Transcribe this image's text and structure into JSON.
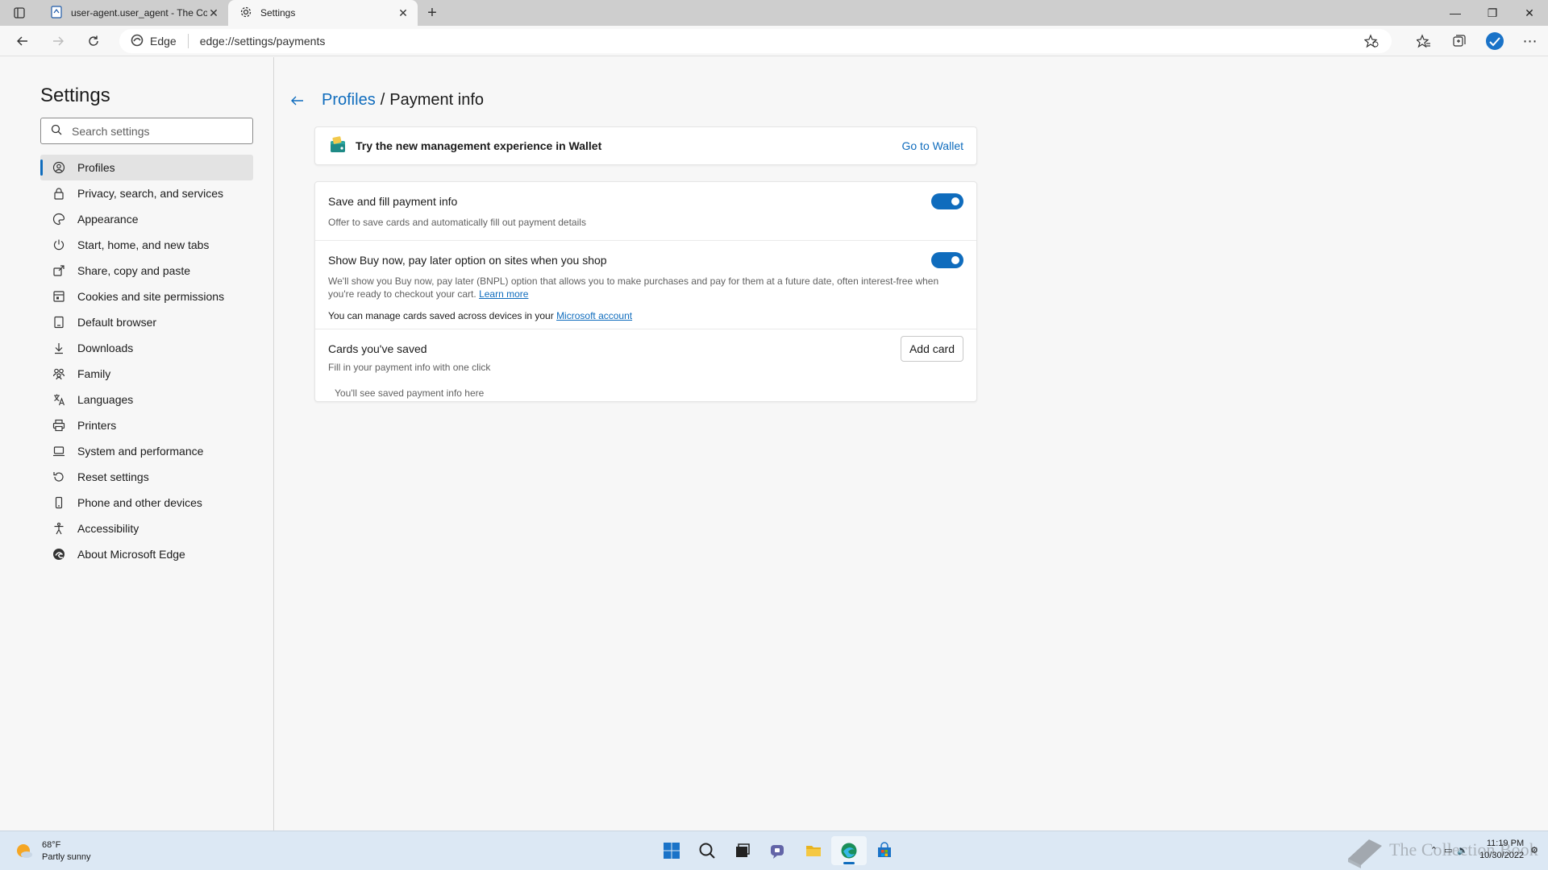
{
  "tabs": [
    {
      "title": "user-agent.user_agent - The Coll",
      "active": false
    },
    {
      "title": "Settings",
      "active": true
    }
  ],
  "address": {
    "site_label": "Edge",
    "url": "edge://settings/payments"
  },
  "sidebar": {
    "title": "Settings",
    "search_placeholder": "Search settings",
    "items": [
      {
        "label": "Profiles",
        "icon": "profile-icon"
      },
      {
        "label": "Privacy, search, and services",
        "icon": "lock-icon"
      },
      {
        "label": "Appearance",
        "icon": "palette-icon"
      },
      {
        "label": "Start, home, and new tabs",
        "icon": "power-icon"
      },
      {
        "label": "Share, copy and paste",
        "icon": "share-icon"
      },
      {
        "label": "Cookies and site permissions",
        "icon": "cookie-icon"
      },
      {
        "label": "Default browser",
        "icon": "browser-icon"
      },
      {
        "label": "Downloads",
        "icon": "download-icon"
      },
      {
        "label": "Family",
        "icon": "family-icon"
      },
      {
        "label": "Languages",
        "icon": "language-icon"
      },
      {
        "label": "Printers",
        "icon": "printer-icon"
      },
      {
        "label": "System and performance",
        "icon": "laptop-icon"
      },
      {
        "label": "Reset settings",
        "icon": "reset-icon"
      },
      {
        "label": "Phone and other devices",
        "icon": "phone-icon"
      },
      {
        "label": "Accessibility",
        "icon": "accessibility-icon"
      },
      {
        "label": "About Microsoft Edge",
        "icon": "edge-icon"
      }
    ]
  },
  "main": {
    "breadcrumb_link": "Profiles",
    "breadcrumb_sep": "/",
    "breadcrumb_current": "Payment info",
    "wallet": {
      "text": "Try the new management experience in Wallet",
      "link": "Go to Wallet"
    },
    "save_fill": {
      "title": "Save and fill payment info",
      "desc": "Offer to save cards and automatically fill out payment details",
      "enabled": true
    },
    "bnpl": {
      "title": "Show Buy now, pay later option on sites when you shop",
      "desc": "We'll show you Buy now, pay later (BNPL) option that allows you to make purchases and pay for them at a future date, often interest-free when you're ready to checkout your cart.",
      "learn_more": "Learn more",
      "enabled": true
    },
    "manage_text": "You can manage cards saved across devices in your",
    "manage_link": "Microsoft account",
    "cards": {
      "title": "Cards you've saved",
      "desc": "Fill in your payment info with one click",
      "add_button": "Add card",
      "empty": "You'll see saved payment info here"
    }
  },
  "taskbar": {
    "temp": "68°F",
    "condition": "Partly sunny",
    "time": "11:19 PM",
    "date": "10/30/2022",
    "watermark": "The Collection Book"
  },
  "colors": {
    "accent": "#0f6cbd",
    "taskbar": "#dce8f4"
  }
}
